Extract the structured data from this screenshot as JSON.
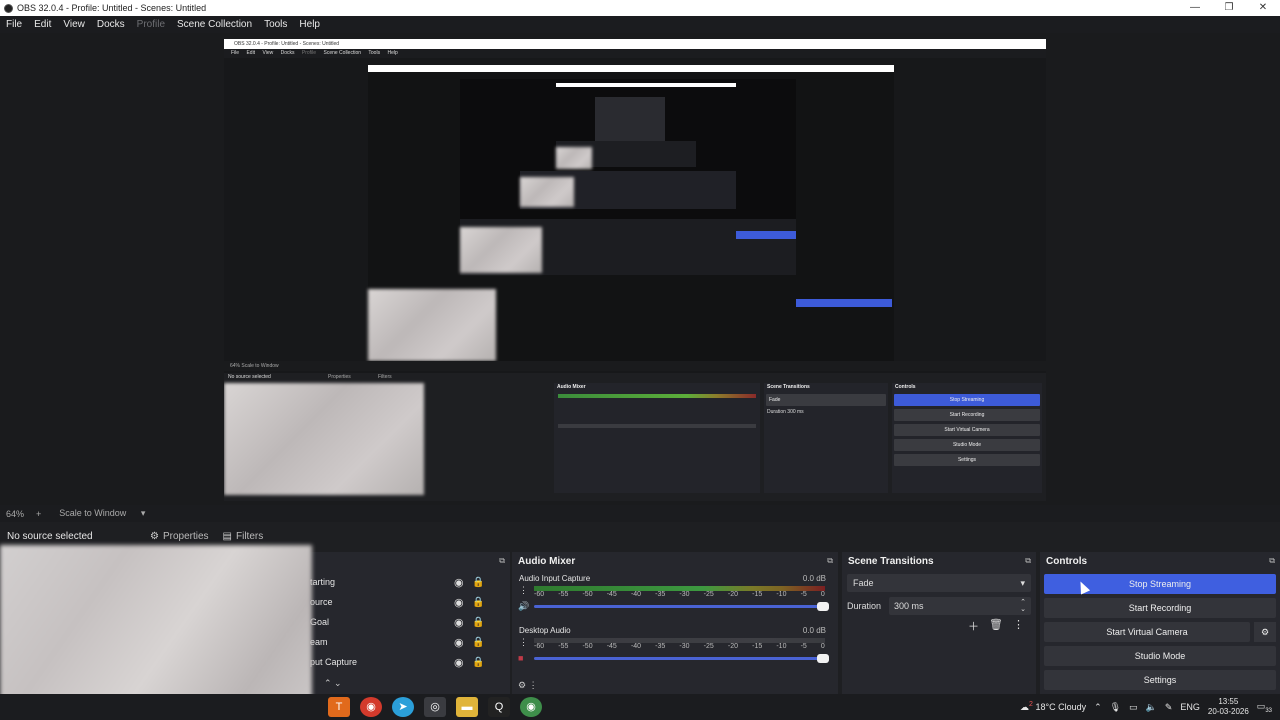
{
  "window": {
    "title": "OBS 32.0.4 - Profile: Untitled - Scenes: Untitled",
    "minimize": "—",
    "maximize": "❐",
    "close": "✕"
  },
  "menu": [
    "File",
    "Edit",
    "View",
    "Docks",
    "Profile",
    "Scene Collection",
    "Tools",
    "Help"
  ],
  "menu_disabled_index": 4,
  "preview": {
    "nested_title": "OBS 32.0.4 - Profile: Untitled - Scenes: Untitled",
    "nested_menu": [
      "File",
      "Edit",
      "View",
      "Docks",
      "Profile",
      "Scene Collection",
      "Tools",
      "Help"
    ],
    "nested_status": "64%   Scale to Window",
    "nested_no_source": "No source selected",
    "nested_properties": "Properties",
    "nested_filters": "Filters",
    "nested_audio_mixer": "Audio Mixer",
    "nested_scene_transitions": "Scene Transitions",
    "nested_controls": "Controls",
    "nested_ctrl_buttons": [
      "Stop Streaming",
      "Start Recording",
      "Start Virtual Camera",
      "Studio Mode",
      "Settings"
    ],
    "nested_fade": "Fade",
    "nested_duration": "Duration   300 ms"
  },
  "toolbar": {
    "zoom": "64%",
    "add": "+",
    "scale": "Scale to Window"
  },
  "context": {
    "no_source": "No source selected",
    "properties": "Properties",
    "filters": "Filters"
  },
  "scenes": {
    "items": [
      "Starting",
      "Source",
      "Goal",
      "Team",
      "Input Capture"
    ],
    "visible_text": [
      "tarting",
      "ource",
      "Goal",
      "eam",
      "put Capture"
    ]
  },
  "mixer": {
    "title": "Audio Mixer",
    "channels": [
      {
        "name": "Audio Input Capture",
        "db": "0.0 dB",
        "level": 0.58
      },
      {
        "name": "Desktop Audio",
        "db": "0.0 dB",
        "level": 0.0
      }
    ],
    "ticks": [
      "-60",
      "-55",
      "-50",
      "-45",
      "-40",
      "-35",
      "-30",
      "-25",
      "-20",
      "-15",
      "-10",
      "-5",
      "0"
    ]
  },
  "transitions": {
    "title": "Scene Transitions",
    "selected": "Fade",
    "duration_label": "Duration",
    "duration_value": "300 ms"
  },
  "controls": {
    "title": "Controls",
    "stop_streaming": "Stop Streaming",
    "start_recording": "Start Recording",
    "start_virtual_camera": "Start Virtual Camera",
    "studio_mode": "Studio Mode",
    "settings": "Settings"
  },
  "taskbar": {
    "weather": "18°C Cloudy",
    "weather_badge": "2",
    "lang": "ENG",
    "time": "13:55",
    "date": "20-03-2026",
    "notif": "33"
  },
  "colors": {
    "accent_blue": "#3f5fe0",
    "panel": "#26272d",
    "bg": "#1e1f22"
  }
}
